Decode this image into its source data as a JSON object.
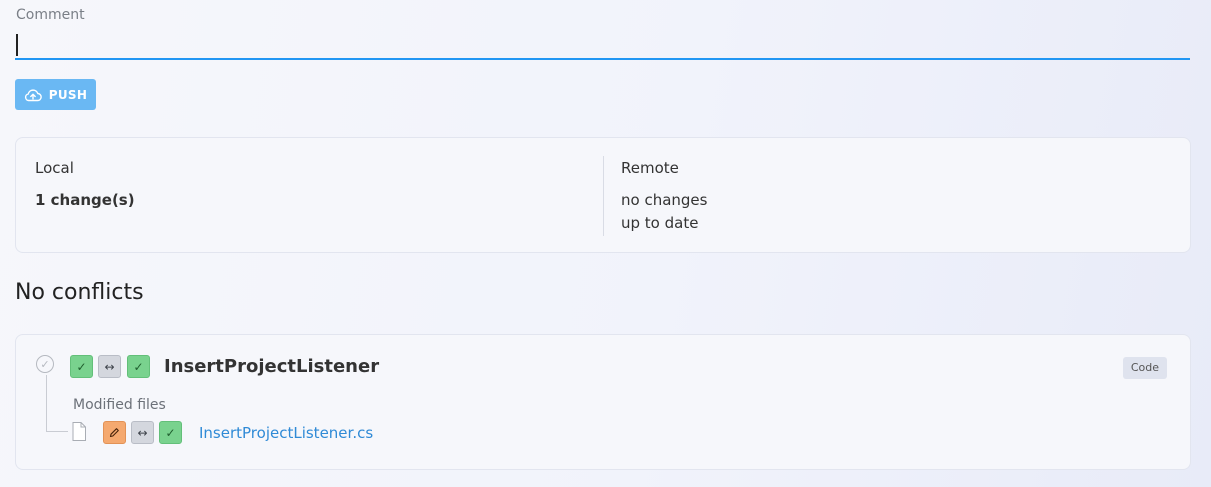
{
  "comment": {
    "label": "Comment",
    "value": "",
    "placeholder": ""
  },
  "push_button": {
    "label": "PUSH",
    "icon": "cloud-upload-icon"
  },
  "status": {
    "local": {
      "heading": "Local",
      "lines": [
        "1 change(s)"
      ]
    },
    "remote": {
      "heading": "Remote",
      "lines": [
        "no changes",
        "up to date"
      ]
    }
  },
  "conflicts_title": "No conflicts",
  "change_item": {
    "title": "InsertProjectListener",
    "badge": "Code",
    "status_chips": [
      "check-icon",
      "swap-icon",
      "check-icon"
    ],
    "modified_label": "Modified files",
    "files": [
      {
        "name": "InsertProjectListener.cs",
        "status_chips": [
          "pencil-icon",
          "swap-icon",
          "check-icon"
        ]
      }
    ]
  },
  "colors": {
    "accent": "#2196f3",
    "push_button": "#6ab8f3",
    "chip_green": "#79d28e",
    "chip_gray": "#d4d7de",
    "chip_orange": "#f5a96f",
    "link": "#2f8ad6"
  }
}
